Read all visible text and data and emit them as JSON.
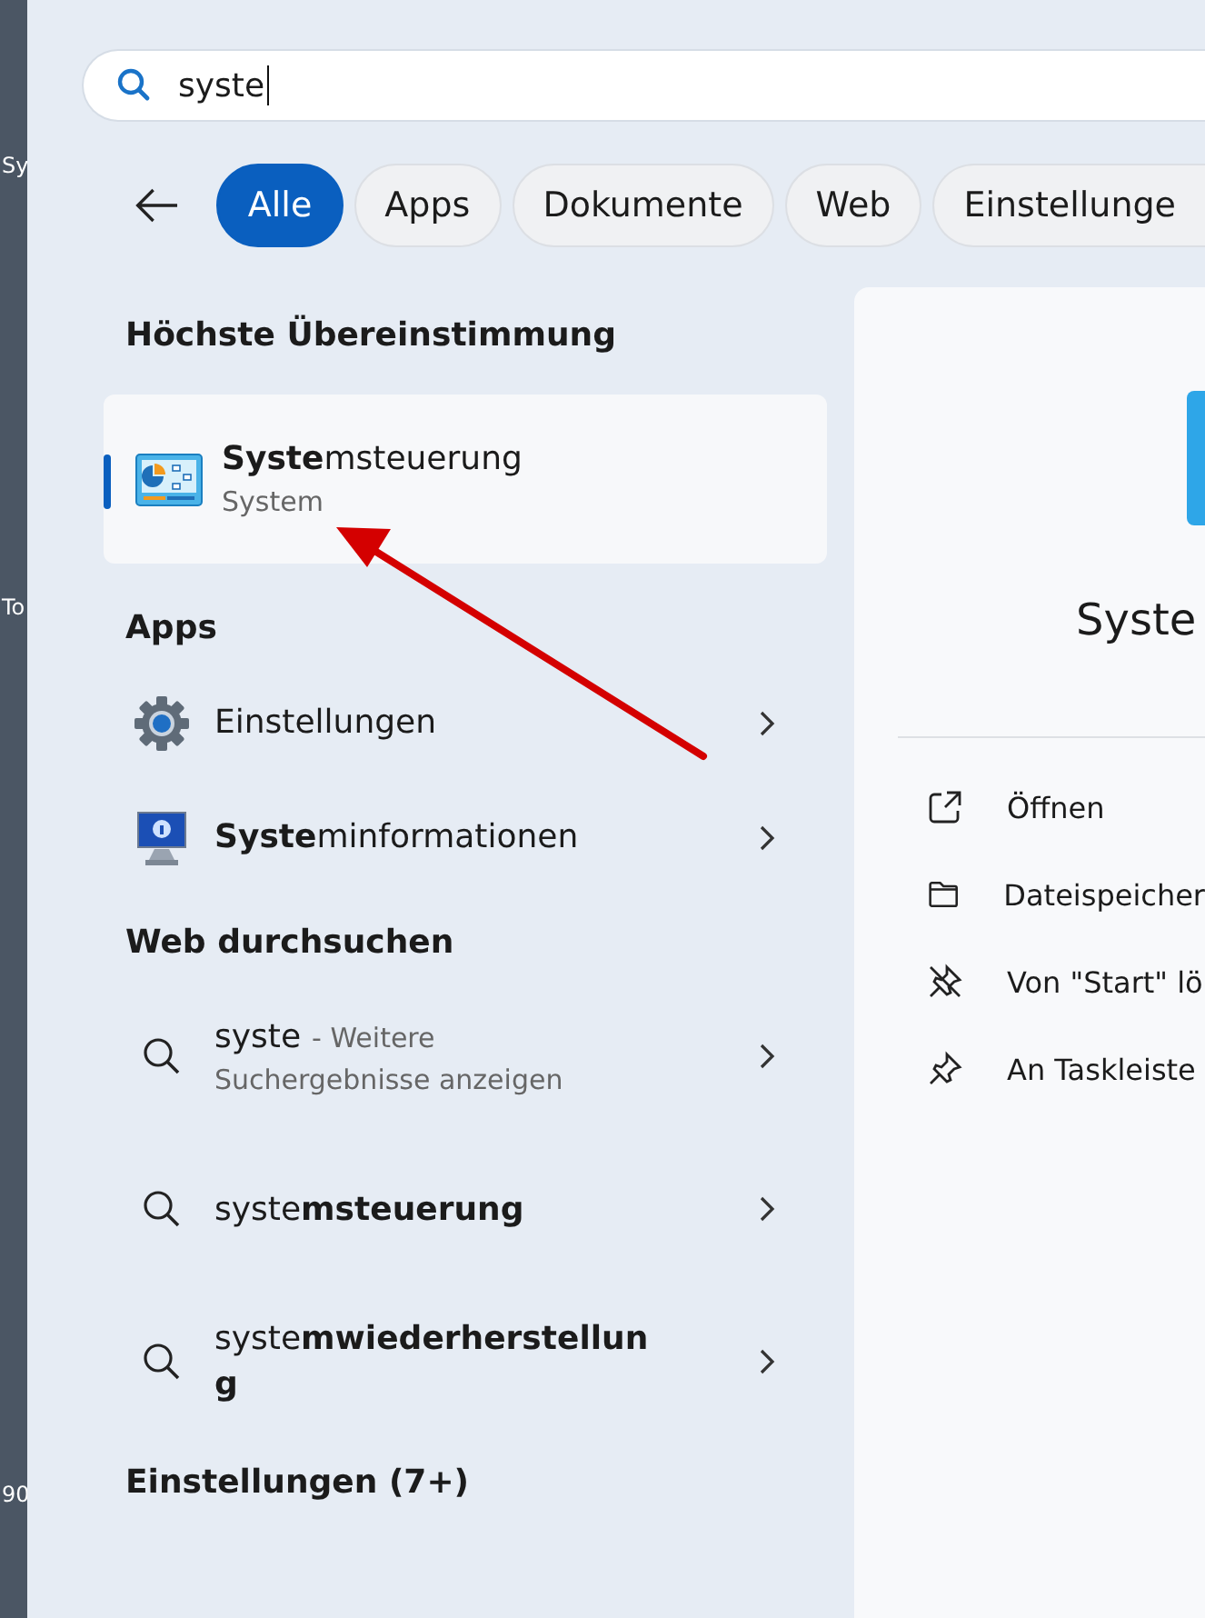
{
  "edge_labels": [
    "Sy",
    "To",
    "90"
  ],
  "search": {
    "value": "syste"
  },
  "filters": [
    {
      "label": "Alle",
      "selected": true
    },
    {
      "label": "Apps",
      "selected": false
    },
    {
      "label": "Dokumente",
      "selected": false
    },
    {
      "label": "Web",
      "selected": false
    },
    {
      "label": "Einstellunge",
      "selected": false
    }
  ],
  "best_match": {
    "heading": "Höchste Übereinstimmung",
    "title": "**Syste**msteuerung",
    "subtitle": "System",
    "selected": true
  },
  "apps": {
    "heading": "Apps",
    "items": [
      {
        "kind": "settings",
        "label": "Einstellungen"
      },
      {
        "kind": "sysinfo",
        "label": "**Syste**minformationen"
      }
    ]
  },
  "web": {
    "heading": "Web durchsuchen",
    "items": [
      {
        "query": "syste",
        "suffix": "- Weitere",
        "detail": "Suchergebnisse anzeigen"
      },
      {
        "query": "syste**msteuerung**"
      },
      {
        "query": "syste**mwiederherstellun**",
        "wrap": "**g**"
      }
    ]
  },
  "settings_heading": "Einstellungen (7+)",
  "preview": {
    "title": "Syste",
    "actions": [
      {
        "kind": "open",
        "label": "Öffnen"
      },
      {
        "kind": "folder",
        "label": "Dateispeicher"
      },
      {
        "kind": "unpin",
        "label": "Von \"Start\" lö"
      },
      {
        "kind": "pin",
        "label": "An Taskleiste"
      }
    ]
  }
}
